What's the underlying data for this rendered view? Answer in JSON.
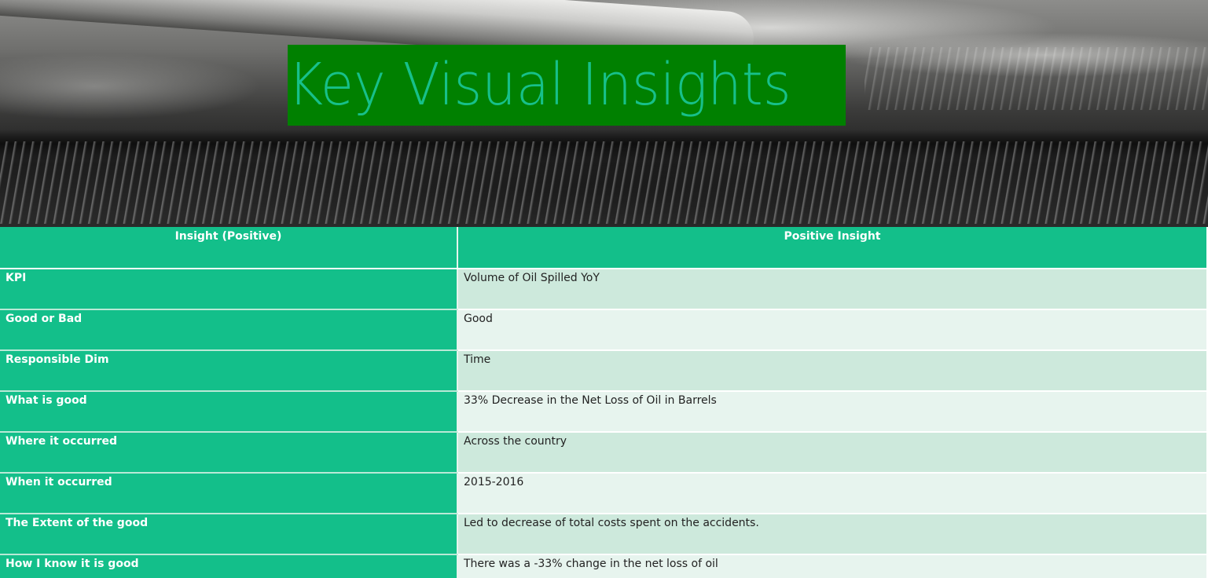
{
  "title": "Key Visual Insights",
  "table": {
    "headers": [
      "Insight (Positive)",
      "Positive Insight"
    ],
    "rows": [
      {
        "label": "KPI",
        "value": "Volume of Oil Spilled YoY"
      },
      {
        "label": "Good or Bad",
        "value": "Good"
      },
      {
        "label": "Responsible Dim",
        "value": "Time"
      },
      {
        "label": "What is good",
        "value": "33% Decrease in the Net Loss of Oil in Barrels"
      },
      {
        "label": "Where it occurred",
        "value": "Across the country"
      },
      {
        "label": "When it occurred",
        "value": "2015-2016"
      },
      {
        "label": "The Extent of the good",
        "value": "Led to decrease of total costs spent on the accidents."
      },
      {
        "label": "How I know it is good",
        "value": "There was a -33% change in the net loss of oil"
      }
    ]
  },
  "colors": {
    "title_bg": "#008000",
    "title_text": "#17c08a",
    "table_accent": "#13bf8a",
    "row_light": "#e7f4ee",
    "row_dark": "#cde9dc"
  }
}
